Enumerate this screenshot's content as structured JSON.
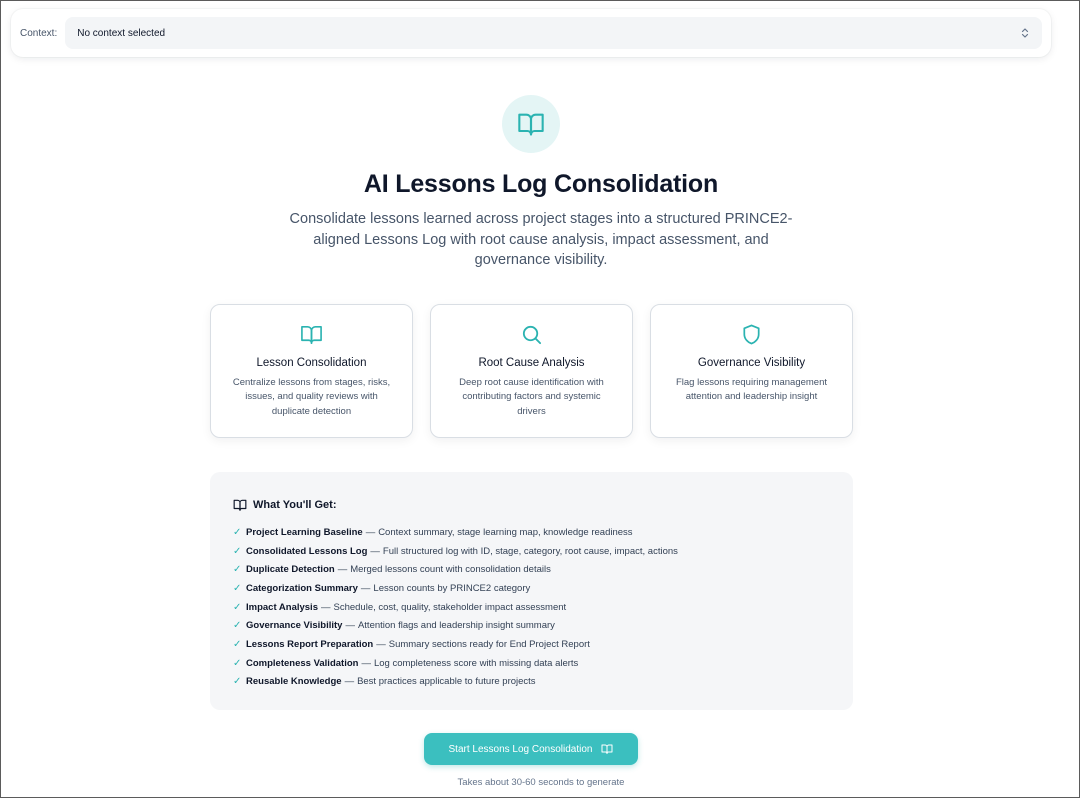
{
  "context": {
    "label": "Context:",
    "selected": "No context selected",
    "chevron_icon": "chevron-up-down-icon"
  },
  "hero": {
    "icon": "book-open-icon",
    "title": "AI Lessons Log Consolidation",
    "subtitle": "Consolidate lessons learned across project stages into a structured PRINCE2-aligned Lessons Log with root cause analysis, impact assessment, and governance visibility."
  },
  "features": [
    {
      "icon": "book-open-icon",
      "title": "Lesson Consolidation",
      "description": "Centralize lessons from stages, risks, issues, and quality reviews with duplicate detection"
    },
    {
      "icon": "search-icon",
      "title": "Root Cause Analysis",
      "description": "Deep root cause identification with contributing factors and systemic drivers"
    },
    {
      "icon": "shield-icon",
      "title": "Governance Visibility",
      "description": "Flag lessons requiring management attention and leadership insight"
    }
  ],
  "benefits": {
    "heading": "What You'll Get:",
    "icon": "book-open-icon",
    "check": "✓",
    "separator": "—",
    "items": [
      {
        "name": "Project Learning Baseline",
        "text": "Context summary, stage learning map, knowledge readiness"
      },
      {
        "name": "Consolidated Lessons Log",
        "text": "Full structured log with ID, stage, category, root cause, impact, actions"
      },
      {
        "name": "Duplicate Detection",
        "text": "Merged lessons count with consolidation details"
      },
      {
        "name": "Categorization Summary",
        "text": "Lesson counts by PRINCE2 category"
      },
      {
        "name": "Impact Analysis",
        "text": "Schedule, cost, quality, stakeholder impact assessment"
      },
      {
        "name": "Governance Visibility",
        "text": "Attention flags and leadership insight summary"
      },
      {
        "name": "Lessons Report Preparation",
        "text": "Summary sections ready for End Project Report"
      },
      {
        "name": "Completeness Validation",
        "text": "Log completeness score with missing data alerts"
      },
      {
        "name": "Reusable Knowledge",
        "text": "Best practices applicable to future projects"
      }
    ]
  },
  "cta": {
    "label": "Start Lessons Log Consolidation",
    "icon": "book-open-icon",
    "note": "Takes about 30-60 seconds to generate"
  },
  "colors": {
    "accent": "#3bbfbf",
    "accent_icon": "#2bb3b1",
    "icon_bg": "#e4f5f5",
    "panel_bg": "#f5f6f8",
    "title_text": "#0f172a",
    "body_text": "#475569"
  }
}
